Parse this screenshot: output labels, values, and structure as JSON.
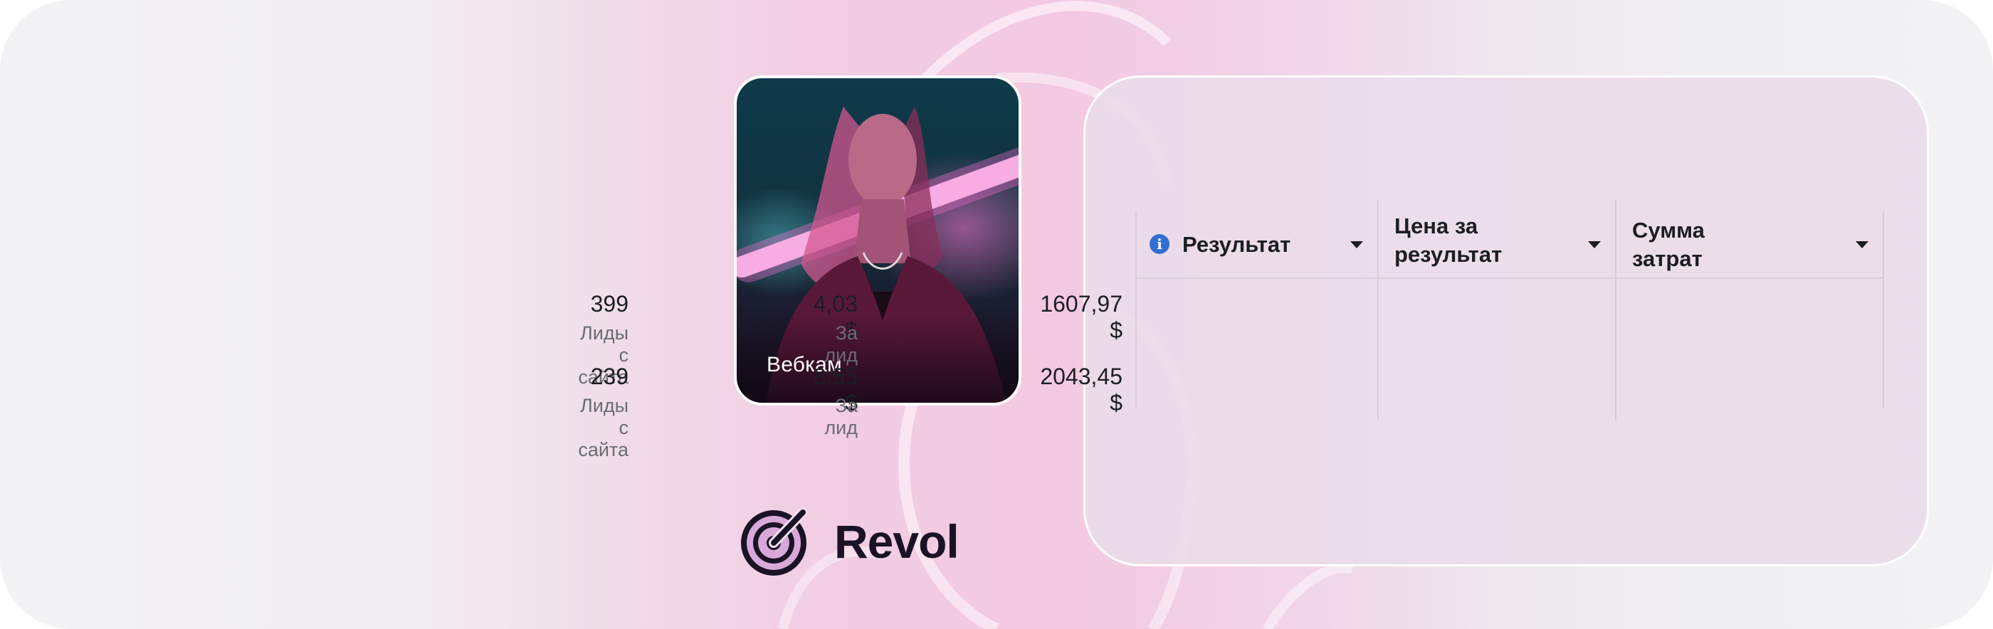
{
  "card": {
    "label": "Вебкам"
  },
  "logo": {
    "text": "Revol"
  },
  "table": {
    "headers": [
      {
        "label": "Результат"
      },
      {
        "label_line1": "Цена за",
        "label_line2": "результат"
      },
      {
        "label": "Сумма затрат"
      }
    ],
    "rows": [
      {
        "result": "399",
        "result_sub": "Лиды с сайта",
        "cost": "4,03 $",
        "cost_sub": "За лид",
        "spend": "1607,97 $"
      },
      {
        "result": "239",
        "result_sub": "Лиды с сайта",
        "cost": "8,55 $",
        "cost_sub": "За лид",
        "spend": "2043,45 $"
      }
    ]
  },
  "colors": {
    "accent_pink": "#f3c9e2",
    "info_blue": "#2f6fd6",
    "text_dark": "#1c1e21",
    "text_muted": "#6a6d72"
  }
}
